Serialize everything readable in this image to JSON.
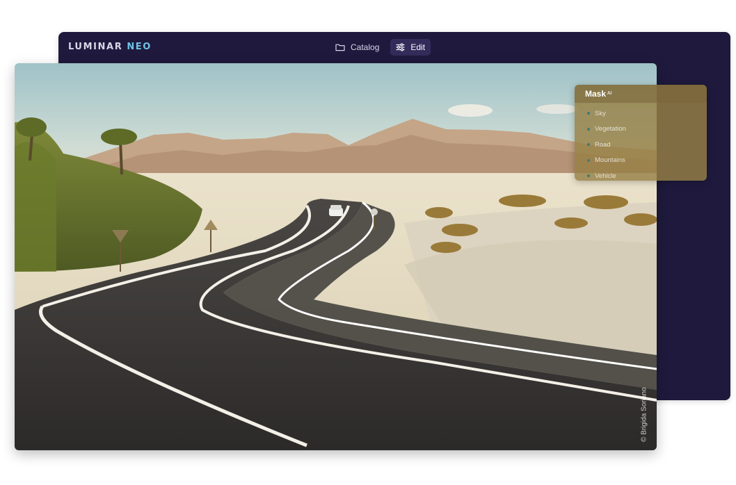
{
  "app": {
    "logo_primary": "LUMINAR",
    "logo_secondary": "NEO"
  },
  "nav": {
    "tabs": [
      {
        "label": "Catalog",
        "icon": "folder-icon",
        "active": false
      },
      {
        "label": "Edit",
        "icon": "sliders-icon",
        "active": true
      }
    ]
  },
  "photo": {
    "subject": "desert-road-landscape",
    "credit": "© Brigida Soriano"
  },
  "mask_panel": {
    "title": "Mask",
    "title_superscript": "AI",
    "items": [
      {
        "label": "Sky"
      },
      {
        "label": "Vegetation"
      },
      {
        "label": "Road"
      },
      {
        "label": "Mountains"
      },
      {
        "label": "Vehicle"
      }
    ]
  },
  "colors": {
    "window_bg": "#1f1a3d",
    "accent": "#6fc3e6",
    "active_tab_bg": "#332c5a",
    "mask_panel_bg": "#96804a"
  }
}
